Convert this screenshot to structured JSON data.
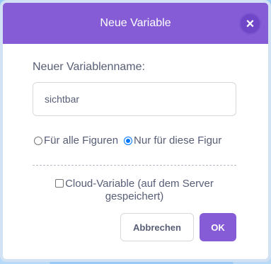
{
  "dialog": {
    "title": "Neue Variable",
    "close_icon": "close-icon",
    "close_glyph": "×",
    "name_label": "Neuer Variablenname:",
    "name_input_placeholder": "sichtbar",
    "scope_options": [
      {
        "label": "Für alle Figuren",
        "selected": false
      },
      {
        "label": "Nur für diese Figur",
        "selected": true
      }
    ],
    "cloud_checkbox_label": "Cloud-Variable (auf dem Server gespeichert)",
    "cloud_checked": false,
    "cancel_label": "Abbrechen",
    "ok_label": "OK"
  },
  "colors": {
    "header": "#855cd6",
    "ok_button": "#855cd6",
    "text": "#575e75",
    "backdrop": "#9ac8f7"
  }
}
